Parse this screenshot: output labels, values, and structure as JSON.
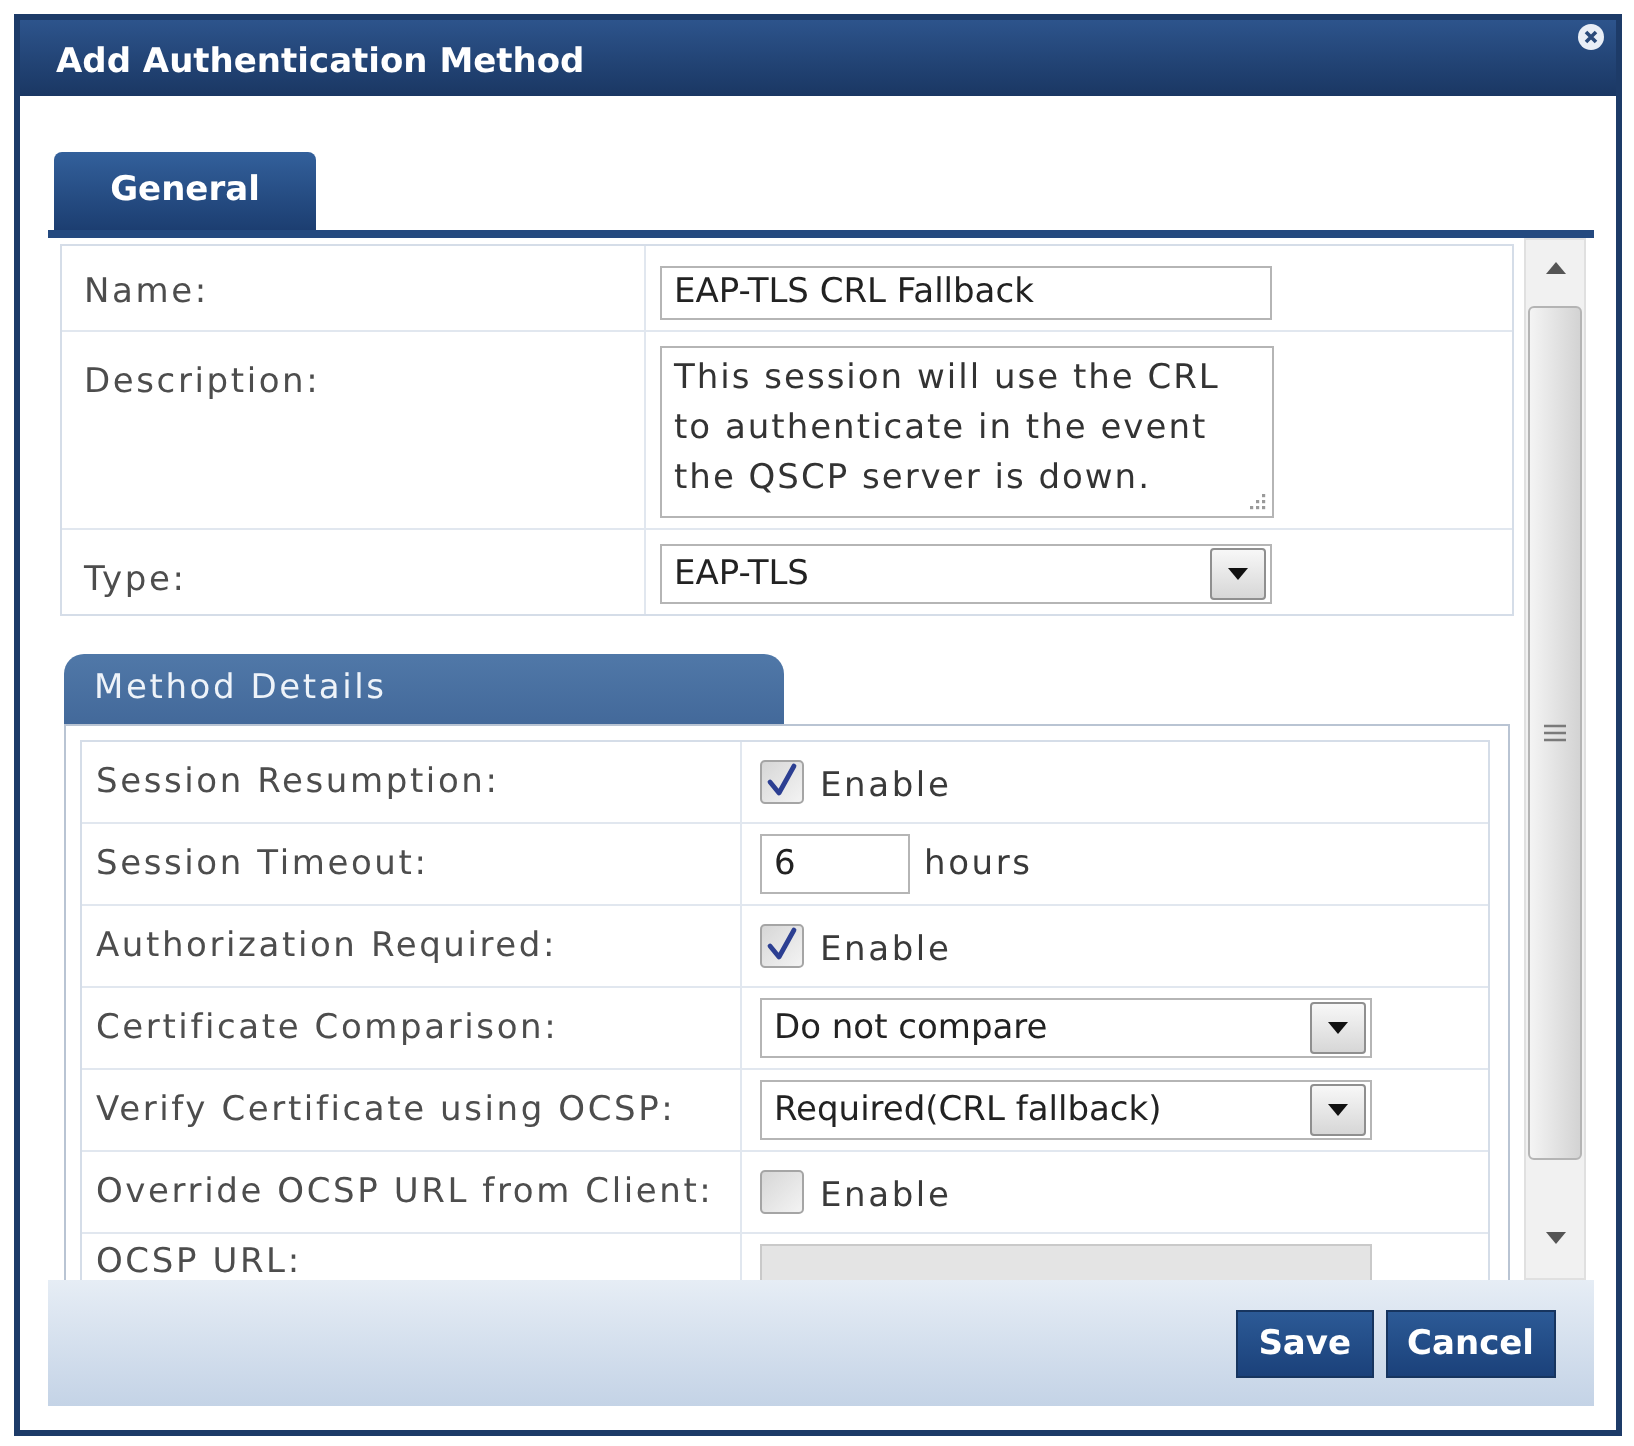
{
  "dialog": {
    "title": "Add Authentication Method"
  },
  "tabs": [
    {
      "label": "General",
      "selected": true
    }
  ],
  "general_fields": [
    {
      "kind": "text",
      "label": "Name:",
      "value": "EAP-TLS CRL Fallback"
    },
    {
      "kind": "textarea",
      "label": "Description:",
      "value": "This session will use the CRL to authenticate in the event the QSCP server is down."
    },
    {
      "kind": "select",
      "label": "Type:",
      "value": "EAP-TLS"
    }
  ],
  "method_details": {
    "title": "Method Details",
    "fields": [
      {
        "kind": "checkbox",
        "label": "Session Resumption:",
        "checked": true,
        "text": "Enable",
        "disabled": false
      },
      {
        "kind": "number",
        "label": "Session Timeout:",
        "value": "6",
        "unit": "hours",
        "disabled": false
      },
      {
        "kind": "checkbox",
        "label": "Authorization Required:",
        "checked": true,
        "text": "Enable",
        "disabled": false
      },
      {
        "kind": "select",
        "label": "Certificate Comparison:",
        "value": "Do not compare",
        "disabled": false
      },
      {
        "kind": "select",
        "label": "Verify Certificate using OCSP:",
        "value": "Required(CRL fallback)",
        "disabled": false
      },
      {
        "kind": "checkbox",
        "label": "Override OCSP URL from Client:",
        "checked": false,
        "text": "Enable",
        "disabled": false
      },
      {
        "kind": "text",
        "label": "OCSP URL:",
        "disabled": true
      }
    ]
  },
  "buttons": [
    {
      "label": "Save"
    },
    {
      "label": "Cancel"
    }
  ]
}
